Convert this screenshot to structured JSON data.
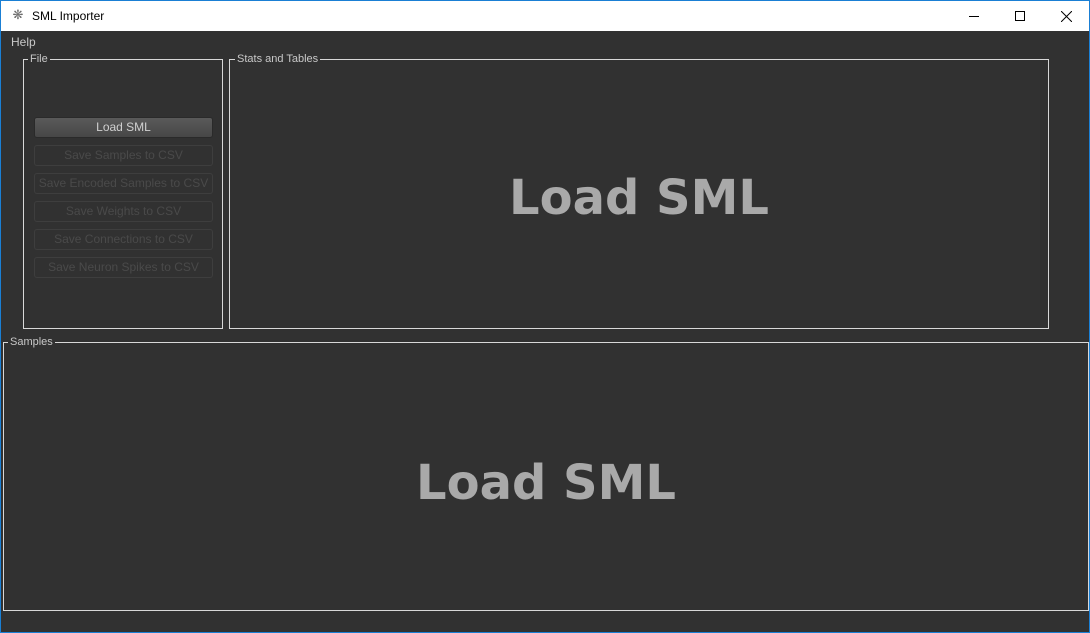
{
  "window": {
    "title": "SML Importer",
    "icon": "app-icon",
    "accent_color": "#1a7fd4"
  },
  "menu": {
    "items": [
      "Help"
    ]
  },
  "file_group": {
    "title": "File",
    "buttons": [
      {
        "label": "Load SML",
        "enabled": true
      },
      {
        "label": "Save Samples to CSV",
        "enabled": false
      },
      {
        "label": "Save Encoded Samples to CSV",
        "enabled": false
      },
      {
        "label": "Save Weights to CSV",
        "enabled": false
      },
      {
        "label": "Save Connections to CSV",
        "enabled": false
      },
      {
        "label": "Save Neuron Spikes to CSV",
        "enabled": false
      }
    ]
  },
  "stats_group": {
    "title": "Stats and Tables",
    "placeholder": "Load SML"
  },
  "samples_group": {
    "title": "Samples",
    "placeholder": "Load SML"
  }
}
